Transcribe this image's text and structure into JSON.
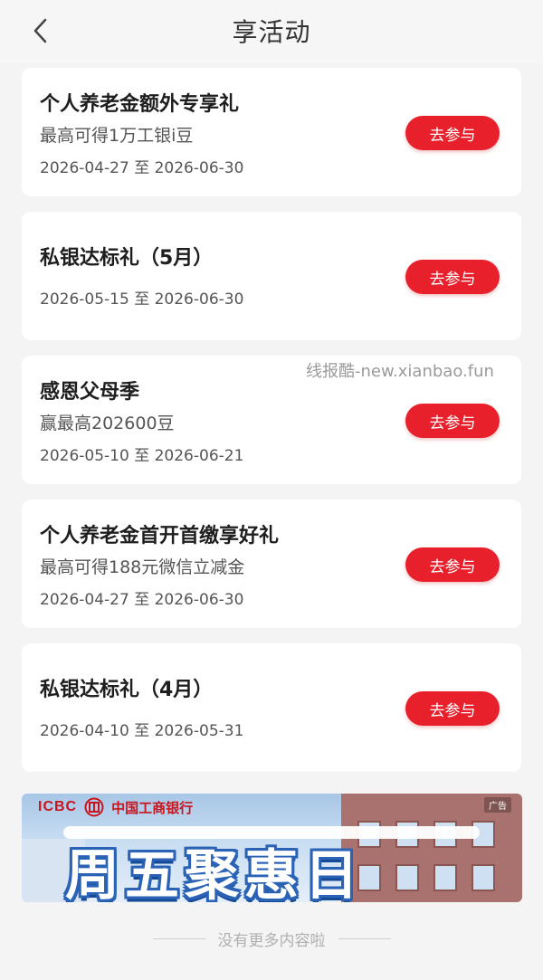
{
  "header": {
    "title": "享活动"
  },
  "activities": [
    {
      "title": "个人养老金额外专享礼",
      "subtitle": "最高可得1万工银i豆",
      "date": "2026-04-27 至 2026-06-30",
      "button": "去参与"
    },
    {
      "title": "私银达标礼（5月）",
      "subtitle": "",
      "date": "2026-05-15 至 2026-06-30",
      "button": "去参与"
    },
    {
      "title": "感恩父母季",
      "subtitle": "赢最高202600豆",
      "date": "2026-05-10 至 2026-06-21",
      "button": "去参与"
    },
    {
      "title": "个人养老金首开首缴享好礼",
      "subtitle": "最高可得188元微信立减金",
      "date": "2026-04-27 至 2026-06-30",
      "button": "去参与"
    },
    {
      "title": "私银达标礼（4月）",
      "subtitle": "",
      "date": "2026-04-10 至 2026-05-31",
      "button": "去参与"
    }
  ],
  "watermark": "线报酷-new.xianbao.fun",
  "banner": {
    "brand": "ICBC",
    "bank_name": "中国工商银行",
    "ad_label": "广告",
    "slogan": "周五聚惠日"
  },
  "footer": {
    "end_text": "没有更多内容啦"
  },
  "colors": {
    "accent": "#e8202b",
    "background": "#f4f4f4",
    "brand_red": "#c8141c"
  },
  "icons": {
    "back": "chevron-left-icon",
    "icbc_logo": "icbc-logo-icon"
  }
}
